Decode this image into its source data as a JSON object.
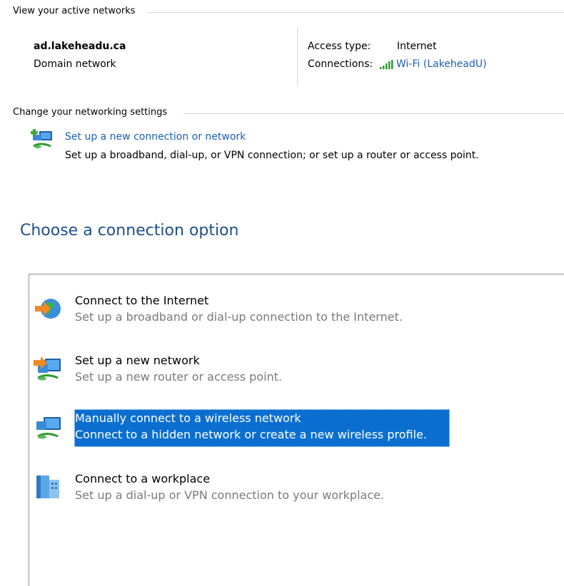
{
  "active_networks": {
    "section_title": "View your active networks",
    "network_name": "ad.lakeheadu.ca",
    "network_type": "Domain network",
    "access_type_label": "Access type:",
    "access_type_value": "Internet",
    "connections_label": "Connections:",
    "connection_link": "Wi-Fi (LakeheadU)",
    "wifi_icon": "wifi-signal-icon"
  },
  "change_settings": {
    "section_title": "Change your networking settings",
    "item": {
      "icon": "network-setup-icon",
      "link": "Set up a new connection or network",
      "description": "Set up a broadband, dial-up, or VPN connection; or set up a router or access point."
    }
  },
  "dialog": {
    "heading": "Choose a connection option",
    "options": [
      {
        "icon": "globe-icon",
        "title": "Connect to the Internet",
        "description": "Set up a broadband or dial-up connection to the Internet.",
        "selected": false
      },
      {
        "icon": "new-network-icon",
        "title": "Set up a new network",
        "description": "Set up a new router or access point.",
        "selected": false
      },
      {
        "icon": "wireless-network-icon",
        "title": "Manually connect to a wireless network",
        "description": "Connect to a hidden network or create a new wireless profile.",
        "selected": true
      },
      {
        "icon": "workplace-icon",
        "title": "Connect to a workplace",
        "description": "Set up a dial-up or VPN connection to your workplace.",
        "selected": false
      }
    ]
  },
  "colors": {
    "link": "#1a5fb4",
    "heading": "#1d4f8c",
    "selection": "#0b6fd0",
    "muted_text": "#7a7a7a"
  }
}
